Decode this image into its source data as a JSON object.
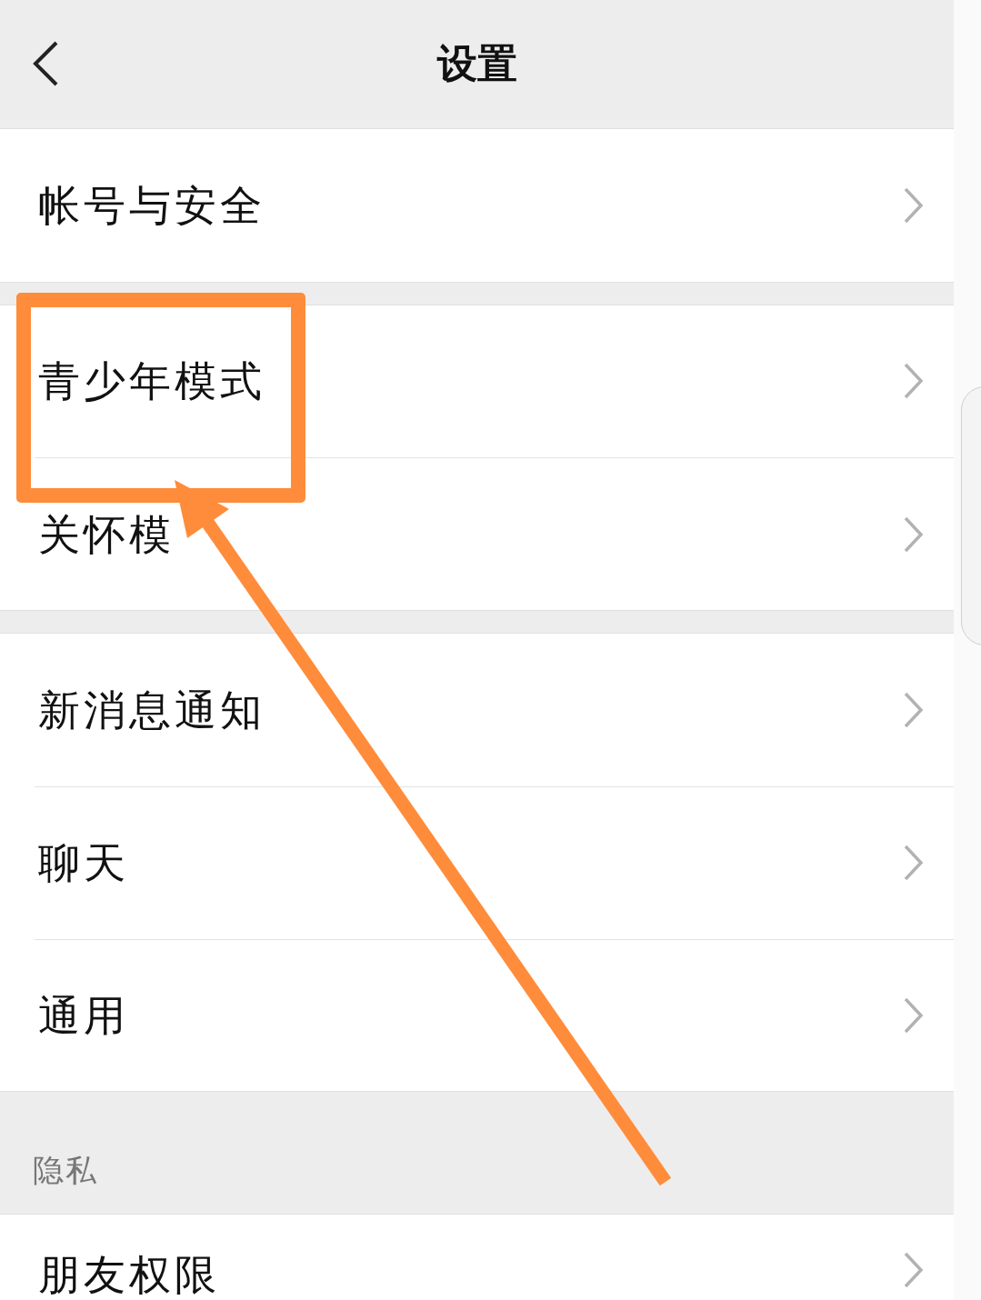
{
  "header": {
    "title": "设置"
  },
  "rows": [
    {
      "kind": "item",
      "label": "帐号与安全"
    },
    {
      "kind": "gap"
    },
    {
      "kind": "item",
      "label": "青少年模式"
    },
    {
      "kind": "item",
      "label": "关怀模"
    },
    {
      "kind": "gap"
    },
    {
      "kind": "item",
      "label": "新消息通知"
    },
    {
      "kind": "item",
      "label": "聊天"
    },
    {
      "kind": "item",
      "label": "通用"
    },
    {
      "kind": "section",
      "label": "隐私"
    },
    {
      "kind": "item",
      "label": "朋友权限"
    }
  ]
}
